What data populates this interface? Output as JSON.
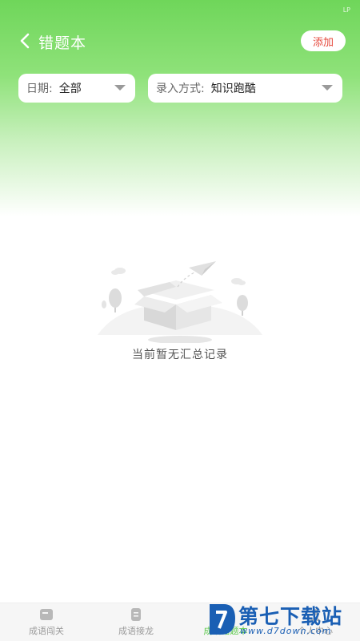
{
  "status": {
    "mark": "LP"
  },
  "header": {
    "title": "错题本",
    "back_icon": "chevron-left-icon",
    "add_label": "添加"
  },
  "filters": {
    "date": {
      "label": "日期:",
      "value": "全部"
    },
    "mode": {
      "label": "录入方式:",
      "value": "知识跑酷"
    }
  },
  "empty_state": {
    "illustration": "empty-box-illustration",
    "message": "当前暂无汇总记录"
  },
  "tabbar": {
    "items": [
      {
        "label": "成语闯关",
        "icon": "card-icon",
        "active": false
      },
      {
        "label": "成语接龙",
        "icon": "document-icon",
        "active": false
      },
      {
        "label": "成语错题本",
        "icon": "notebook-icon",
        "active": true
      },
      {
        "label": "个人中心",
        "icon": "person-icon",
        "active": false
      }
    ]
  },
  "watermark": {
    "title": "第七下载站",
    "url": "www.d7down.com"
  },
  "colors": {
    "accent": "#5cc94a",
    "header_green": "#6fd65a",
    "add_text": "#e5483c",
    "watermark_blue": "#1a5fb4"
  }
}
